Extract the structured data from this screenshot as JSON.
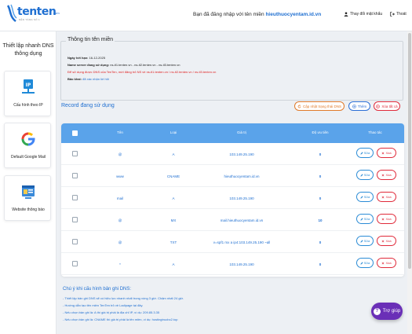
{
  "header": {
    "logo_text": "tenten",
    "logo_com": ".com",
    "logo_tagline": "NỀN TẢNG SỐ 1",
    "login_prefix": "Bạn đã đăng nhập với tên miền ",
    "login_domain": "hieuthuocyentam.id.vn",
    "change_password": "Thay đổi mật khẩu",
    "logout": "Thoát"
  },
  "sidebar": {
    "title": "Thiết lập nhanh DNS thông dụng",
    "cards": [
      {
        "label": "Cấu hình theo IP",
        "icon": "ip-icon"
      },
      {
        "label": "Default Google Mail",
        "icon": "gmail-icon"
      },
      {
        "label": "Website thông báo",
        "icon": "website-icon"
      }
    ]
  },
  "domain_info": {
    "legend": "Thông tin tên miền",
    "expiry_label": "Ngày hết hạn:",
    "expiry_value": "16-12-2025",
    "nameserver_label": "Name server đang sử dụng:",
    "nameserver_value": "ns-tl1.tenten.vn - ns-tl2.tenten.vn - ns-tl3.tenten.vn",
    "warning": "Để sử dụng được DNS của TenTen, mời đăng trỏ NS về ns-tl1.tenten.vn / ns-tl2.tenten.vn / ns-tl3.tenten.vn",
    "status_label": "Bảo khai:",
    "status_value": "đã xác nhận lời hỏi"
  },
  "records": {
    "title": "Record đang sử dụng",
    "update_button": "Cập nhật trạng thái DNS",
    "add_button": "Thêm",
    "delete_all_button": "Xóa tất cả",
    "columns": [
      "Tên",
      "Loại",
      "Giá trị",
      "Độ ưu tiên",
      "Thao tác"
    ],
    "rows": [
      {
        "name": "@",
        "type": "A",
        "value": "103.149.25.190",
        "priority": "0"
      },
      {
        "name": "www",
        "type": "CNAME",
        "value": "hieuthuocyentam.id.vn",
        "priority": "0"
      },
      {
        "name": "mail",
        "type": "A",
        "value": "103.149.25.190",
        "priority": "0"
      },
      {
        "name": "@",
        "type": "MX",
        "value": "mail.hieuthuocyentam.id.vn",
        "priority": "10"
      },
      {
        "name": "@",
        "type": "TXT",
        "value": "v=spf1 mx a ip4:103.149.25.190 ~all",
        "priority": "0"
      },
      {
        "name": "*",
        "type": "A",
        "value": "103.149.25.190",
        "priority": "0"
      }
    ],
    "edit_label": "Sửa",
    "delete_label": "Xóa"
  },
  "notes": {
    "title": "Chú ý khi cấu hình bản ghi DNS:",
    "items": [
      "- Thiết lập bản ghi DNS sẽ có hiệu lực nhanh nhất trong vòng 3 giờ. Chậm nhất 24 giờ.",
      "- Hướng dẫn tạo tên miền TenTen trỏ về Ladipage tại đây.",
      "- Nếu chọn bản ghi là: A thì giá trị phải là địa chỉ IP, ví dụ: 209.85.3.35",
      "- Nếu chọn bản ghi là: CNAME thì giá trị phải là tên miền, ví dụ: hostingtruobc2.top"
    ]
  },
  "help_button": "Trợ giúp",
  "colors": {
    "primary": "#1f6fd1",
    "table_header": "#5aa3ea",
    "danger": "#e02a3a",
    "warning": "#e07a2a",
    "help": "#6a2fb7"
  }
}
